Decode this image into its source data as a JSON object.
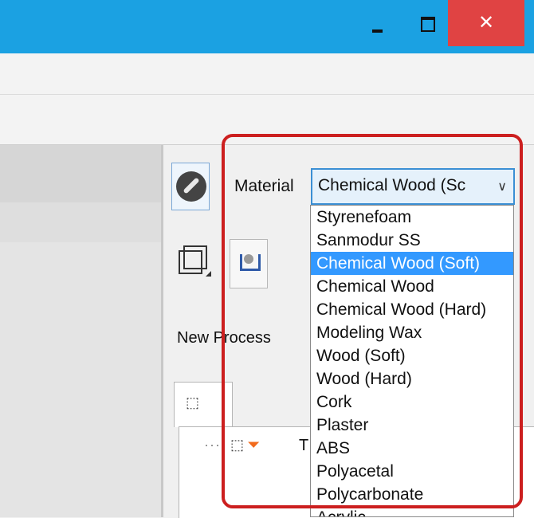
{
  "window": {
    "minimize_glyph": "",
    "maximize_glyph": "",
    "close_glyph": "✕"
  },
  "panel": {
    "material_label": "Material",
    "material_selected": "Chemical Wood (Sc",
    "new_process_label": "New Process",
    "tree_row_text": "T"
  },
  "material_options": [
    "Styrenefoam",
    "Sanmodur SS",
    "Chemical Wood (Soft)",
    "Chemical Wood",
    "Chemical Wood (Hard)",
    "Modeling Wax",
    "Wood (Soft)",
    "Wood (Hard)",
    "Cork",
    "Plaster",
    "ABS",
    "Polyacetal",
    "Polycarbonate",
    "Acrylic"
  ],
  "selected_index": 2,
  "colors": {
    "titlebar": "#1ba1e2",
    "close": "#e04343",
    "highlight_border": "#cc1f1f",
    "selection": "#3399ff"
  },
  "icons": [
    "compass-icon",
    "box-view-icon",
    "tool-icon",
    "cube-icon",
    "funnel-icon",
    "chevron-down-icon"
  ]
}
